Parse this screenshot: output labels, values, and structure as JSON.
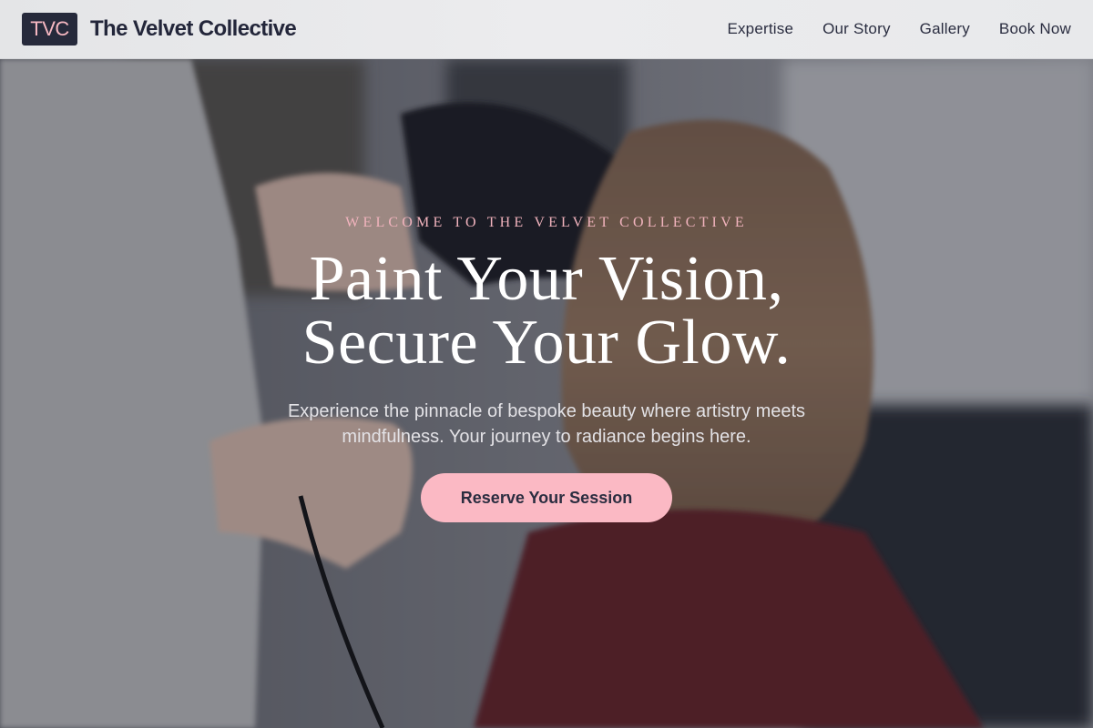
{
  "brand": {
    "logo_text": "TVC",
    "name": "The Velvet Collective"
  },
  "nav": {
    "items": [
      {
        "label": "Expertise"
      },
      {
        "label": "Our Story"
      },
      {
        "label": "Gallery"
      },
      {
        "label": "Book Now"
      }
    ]
  },
  "hero": {
    "eyebrow": "WELCOME TO THE VELVET COLLECTIVE",
    "headline_line1": "Paint Your Vision,",
    "headline_line2": "Secure Your Glow.",
    "subtext": "Experience the pinnacle of bespoke beauty where artistry meets mindfulness. Your journey to radiance begins here.",
    "cta_label": "Reserve Your Session",
    "background_image": "salon-stylist-blow-drying-hair-photo"
  },
  "colors": {
    "accent_pink": "#fbb9c4",
    "brand_navy": "#262a3b",
    "overlay": "#181a28"
  }
}
